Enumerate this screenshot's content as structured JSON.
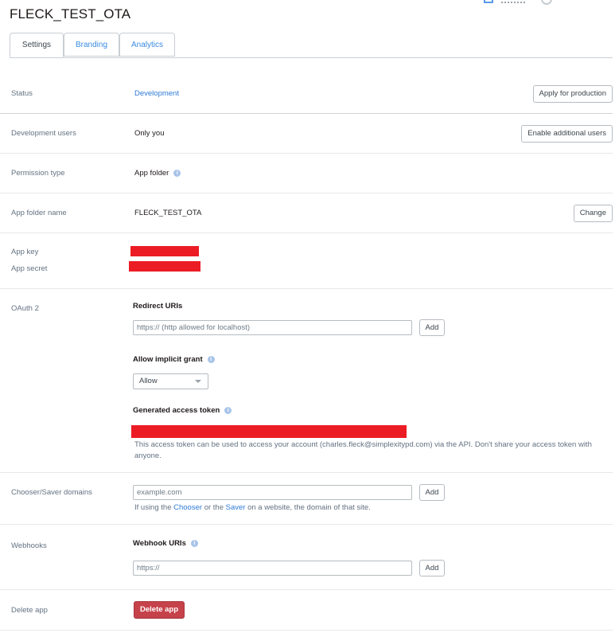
{
  "app": {
    "title": "FLECK_TEST_OTA"
  },
  "tabs": [
    {
      "label": "Settings"
    },
    {
      "label": "Branding"
    },
    {
      "label": "Analytics"
    }
  ],
  "status": {
    "label": "Status",
    "value": "Development",
    "button": "Apply for production"
  },
  "dev_users": {
    "label": "Development users",
    "value": "Only you",
    "button": "Enable additional users"
  },
  "permission": {
    "label": "Permission type",
    "value": "App folder",
    "info": "i"
  },
  "app_folder": {
    "label": "App folder name",
    "value": "FLECK_TEST_OTA",
    "button": "Change"
  },
  "keys": {
    "key_label": "App key",
    "secret_label": "App secret"
  },
  "oauth": {
    "label": "OAuth 2",
    "redirect_heading": "Redirect URIs",
    "redirect_placeholder": "https:// (http allowed for localhost)",
    "add_button": "Add",
    "implicit_heading": "Allow implicit grant",
    "implicit_value": "Allow",
    "token_heading": "Generated access token",
    "token_help": "This access token can be used to access your account (charles.fleck@simplexitypd.com) via the API. Don't share your access token with anyone."
  },
  "chooser": {
    "label": "Chooser/Saver domains",
    "placeholder": "example.com",
    "add_button": "Add",
    "help_prefix": "If using the",
    "help_chooser": "Chooser",
    "help_or": "or the",
    "help_saver": "Saver",
    "help_suffix": "on a website, the domain of that site."
  },
  "webhooks": {
    "label": "Webhooks",
    "heading": "Webhook URIs",
    "placeholder": "https://",
    "add_button": "Add"
  },
  "delete": {
    "label": "Delete app",
    "button": "Delete app"
  },
  "colors": {
    "link": "#2f7bd6",
    "danger": "#c6424a",
    "redaction": "#ec1c24"
  }
}
